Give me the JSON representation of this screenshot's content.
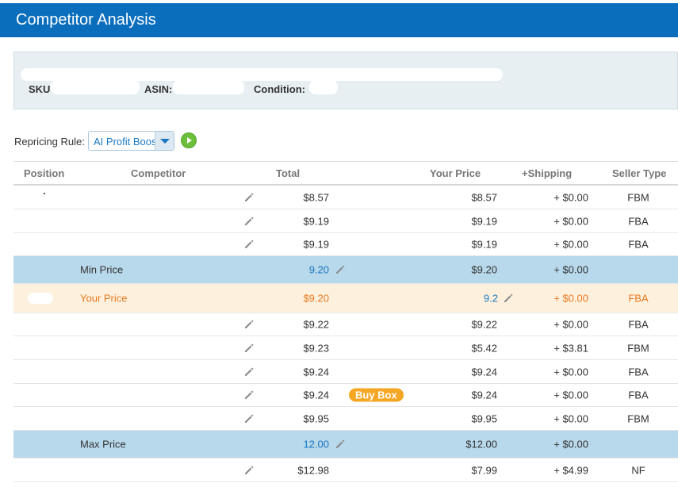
{
  "header": {
    "title": "Competitor Analysis"
  },
  "info": {
    "sku_label": "SKU",
    "asin_label": "ASIN:",
    "condition_label": "Condition:"
  },
  "rule": {
    "label": "Repricing Rule:",
    "selected": "AI Profit Boost",
    "run_icon": "play-circle-icon",
    "dropdown_icon": "caret-down-icon"
  },
  "columns": [
    "Position",
    "Competitor",
    "Total",
    "Your Price",
    "+Shipping",
    "Seller Type"
  ],
  "rows": [
    {
      "kind": "competitor",
      "total": "$8.57",
      "your_price": "$8.57",
      "shipping": "+ $0.00",
      "seller_type": "FBM"
    },
    {
      "kind": "competitor",
      "total": "$9.19",
      "your_price": "$9.19",
      "shipping": "+ $0.00",
      "seller_type": "FBA"
    },
    {
      "kind": "competitor",
      "total": "$9.19",
      "your_price": "$9.19",
      "shipping": "+ $0.00",
      "seller_type": "FBA"
    },
    {
      "kind": "min",
      "label": "Min Price",
      "total": "9.20",
      "your_price": "$9.20",
      "shipping": "+ $0.00",
      "seller_type": ""
    },
    {
      "kind": "your",
      "label": "Your Price",
      "total": "$9.20",
      "your_price": "9.2",
      "shipping": "+ $0.00",
      "seller_type": "FBA"
    },
    {
      "kind": "competitor",
      "total": "$9.22",
      "your_price": "$9.22",
      "shipping": "+ $0.00",
      "seller_type": "FBA"
    },
    {
      "kind": "competitor",
      "total": "$9.23",
      "your_price": "$5.42",
      "shipping": "+ $3.81",
      "seller_type": "FBM"
    },
    {
      "kind": "competitor",
      "total": "$9.24",
      "your_price": "$9.24",
      "shipping": "+ $0.00",
      "seller_type": "FBA"
    },
    {
      "kind": "competitor",
      "total": "$9.24",
      "badge": "Buy Box",
      "your_price": "$9.24",
      "shipping": "+ $0.00",
      "seller_type": "FBA"
    },
    {
      "kind": "competitor",
      "total": "$9.95",
      "your_price": "$9.95",
      "shipping": "+ $0.00",
      "seller_type": "FBM"
    },
    {
      "kind": "max",
      "label": "Max Price",
      "total": "12.00",
      "your_price": "$12.00",
      "shipping": "+ $0.00",
      "seller_type": ""
    },
    {
      "kind": "competitor",
      "total": "$12.98",
      "your_price": "$7.99",
      "shipping": "+ $4.99",
      "seller_type": "NF"
    }
  ],
  "colors": {
    "header_bg": "#0a6ebd",
    "band_blue": "#b8d8eb",
    "band_orange": "#fdf1de",
    "accent_orange": "#e8791e",
    "link_blue": "#1a78c2",
    "badge": "#f5a623"
  },
  "icons": {
    "edit": "pencil-icon"
  }
}
